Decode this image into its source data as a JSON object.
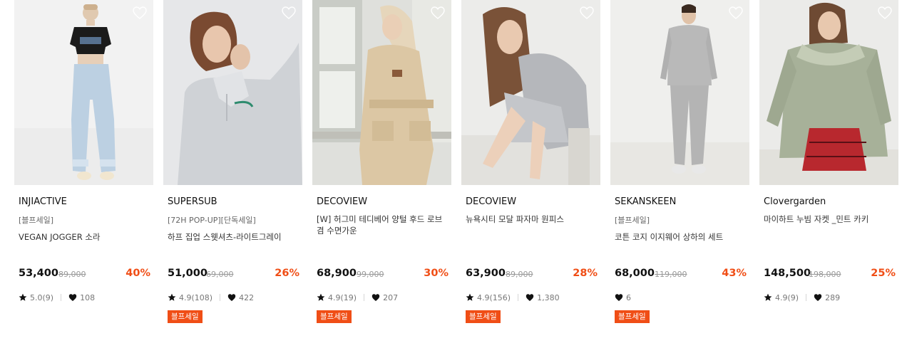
{
  "colors": {
    "discount": "#f04e16",
    "badge_bg": "#f04e16",
    "text": "#111111",
    "muted": "#777777"
  },
  "products": [
    {
      "brand": "INJIACTIVE",
      "tag": "[블프세일]",
      "name": "VEGAN JOGGER 소라",
      "price": "53,400",
      "original_price": "89,000",
      "discount": "40%",
      "rating": "5.0(9)",
      "likes": "108",
      "badge": ""
    },
    {
      "brand": "SUPERSUB",
      "tag": "[72H POP-UP][단독세일]",
      "name": "하프 집업 스웻셔츠-라이트그레이",
      "price": "51,000",
      "original_price": "69,000",
      "discount": "26%",
      "rating": "4.9(108)",
      "likes": "422",
      "badge": "블프세일"
    },
    {
      "brand": "DECOVIEW",
      "tag": "",
      "name": "[W] 허그미 테디베어 양털 후드 로브겸 수면가운",
      "price": "68,900",
      "original_price": "99,000",
      "discount": "30%",
      "rating": "4.9(19)",
      "likes": "207",
      "badge": "블프세일"
    },
    {
      "brand": "DECOVIEW",
      "tag": "",
      "name": "뉴욕시티 모달 파자마 원피스",
      "price": "63,900",
      "original_price": "89,000",
      "discount": "28%",
      "rating": "4.9(156)",
      "likes": "1,380",
      "badge": "블프세일"
    },
    {
      "brand": "SEKANSKEEN",
      "tag": "[블프세일]",
      "name": "코튼 코지 이지웨어 상하의 세트",
      "price": "68,000",
      "original_price": "119,000",
      "discount": "43%",
      "rating": "",
      "likes": "6",
      "badge": "블프세일"
    },
    {
      "brand": "Clovergarden",
      "tag": "",
      "name": "마이하트 누빔 자켓 _민트 카키",
      "price": "148,500",
      "original_price": "198,000",
      "discount": "25%",
      "rating": "4.9(9)",
      "likes": "289",
      "badge": ""
    }
  ]
}
